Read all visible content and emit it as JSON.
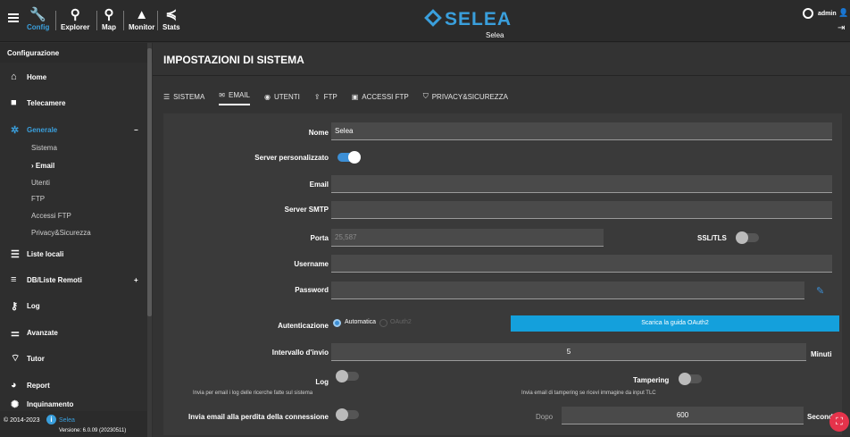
{
  "topbar": {
    "items": [
      {
        "label": "Config",
        "icon": "wrench-icon"
      },
      {
        "label": "Explorer",
        "icon": "explorer-icon"
      },
      {
        "label": "Map",
        "icon": "map-pin-icon"
      },
      {
        "label": "Monitor",
        "icon": "bell-icon"
      },
      {
        "label": "Stats",
        "icon": "stats-icon"
      }
    ],
    "brand": "SELEA",
    "brand_sub": "Selea",
    "user": "admin"
  },
  "sidebar": {
    "header": "Configurazione",
    "items": [
      {
        "label": "Home",
        "icon": "home-icon"
      },
      {
        "label": "Telecamere",
        "icon": "camera-icon"
      },
      {
        "label": "Generale",
        "icon": "gear-icon",
        "expander": "−"
      },
      {
        "label": "Liste locali",
        "icon": "list-icon"
      },
      {
        "label": "DB/Liste Remoti",
        "icon": "db-icon",
        "expander": "+"
      },
      {
        "label": "Log",
        "icon": "key-icon"
      },
      {
        "label": "Avanzate",
        "icon": "sliders-icon"
      },
      {
        "label": "Tutor",
        "icon": "wifi-icon"
      },
      {
        "label": "Report",
        "icon": "pie-icon"
      },
      {
        "label": "Inquinamento",
        "icon": "pollution-icon"
      }
    ],
    "subitems": [
      "Sistema",
      "Email",
      "Utenti",
      "FTP",
      "Accessi FTP",
      "Privacy&Sicurezza"
    ],
    "active_sub": "Email",
    "footer_copy": "© 2014-2023",
    "footer_brand": "Selea",
    "footer_version": "Versione: 6.0.09 (20230511)"
  },
  "main": {
    "title": "IMPOSTAZIONI DI SISTEMA",
    "tabs": [
      "SISTEMA",
      "EMAIL",
      "UTENTI",
      "FTP",
      "ACCESSI FTP",
      "PRIVACY&SICUREZZA"
    ],
    "active_tab": "EMAIL"
  },
  "form": {
    "nome_label": "Nome",
    "nome_value": "Selea",
    "server_pers_label": "Server personalizzato",
    "server_pers_on": true,
    "email_label": "Email",
    "email_value": "",
    "smtp_label": "Server SMTP",
    "smtp_value": "",
    "porta_label": "Porta",
    "porta_placeholder": "25,587",
    "ssl_label": "SSL/TLS",
    "ssl_on": false,
    "username_label": "Username",
    "username_value": "",
    "password_label": "Password",
    "password_value": "",
    "auth_label": "Autenticazione",
    "auth_options": [
      "Automatica",
      "OAuth2"
    ],
    "auth_selected": "Automatica",
    "oauth_button": "Scarica la guida OAuth2",
    "intervallo_label": "Intervallo d'invio",
    "intervallo_value": "5",
    "intervallo_unit": "Minuti",
    "log_label": "Log",
    "log_desc": "Invia per email i log delle ricerche fatte sul sistema",
    "log_on": false,
    "tampering_label": "Tampering",
    "tampering_desc": "Invia email di tampering se ricevi immagine da input TLC",
    "tampering_on": false,
    "perdita_label": "Invia email alla perdita della connessione",
    "perdita_on": false,
    "dopo_label": "Dopo",
    "dopo_value": "600",
    "secondi_label": "Secondi"
  },
  "colors": {
    "accent": "#3c8fd6",
    "button": "#14a0dc",
    "danger": "#e5334b"
  }
}
